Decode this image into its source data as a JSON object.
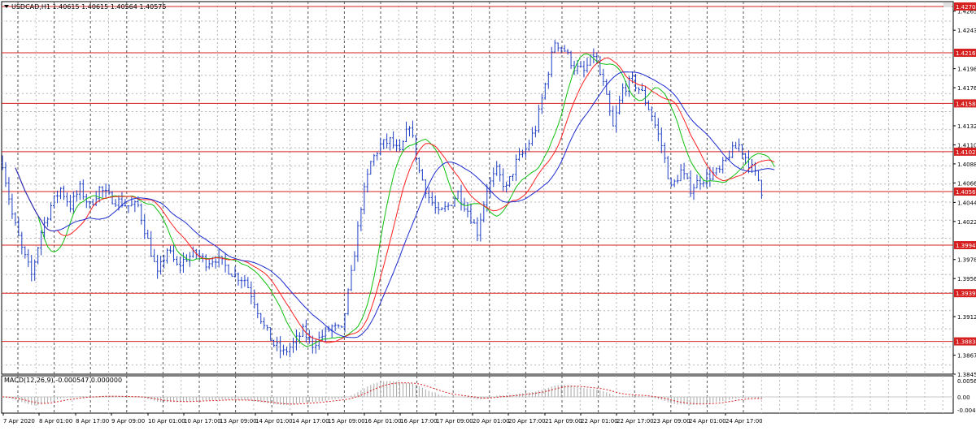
{
  "header": {
    "symbol_text": "USDCAD,H1  1.40615 1.40615 1.40564 1.40575"
  },
  "macd": {
    "label": "MACD(12,26,9) -0.000547 0.000000",
    "ticks": [
      {
        "value": 0.005615,
        "label": "0.005615"
      },
      {
        "value": 0.0,
        "label": "0.00"
      },
      {
        "value": -0.0045,
        "label": "-0.00455"
      }
    ]
  },
  "colors": {
    "background": "#ffffff",
    "grid": "#b8b8b8",
    "price_bar": "#1f3fc4",
    "level_line": "#d62020",
    "level_tag": "#d62020",
    "ma_fast": "#10c010",
    "ma_mid": "#ff2020",
    "ma_slow": "#1a2ad0",
    "macd_hist": "#a8a8a8",
    "macd_signal": "#d62020"
  },
  "chart_data": {
    "type": "candlestick",
    "symbol": "USDCAD",
    "timeframe": "H1",
    "ylim": [
      1.38455,
      1.4276
    ],
    "x_categories": [
      "7 Apr 2020",
      "8 Apr 01:00",
      "8 Apr 17:00",
      "9 Apr 09:00",
      "10 Apr 01:00",
      "10 Apr 17:00",
      "13 Apr 09:00",
      "14 Apr 01:00",
      "14 Apr 17:00",
      "15 Apr 09:00",
      "16 Apr 01:00",
      "16 Apr 17:00",
      "17 Apr 09:00",
      "20 Apr 01:00",
      "20 Apr 17:00",
      "21 Apr 09:00",
      "22 Apr 01:00",
      "22 Apr 17:00",
      "23 Apr 09:00",
      "24 Apr 01:00",
      "24 Apr 17:00"
    ],
    "y_ticks": [
      {
        "value": 1.4265,
        "label": "1.42650"
      },
      {
        "value": 1.4243,
        "label": "1.42430"
      },
      {
        "value": 1.41985,
        "label": "1.41985"
      },
      {
        "value": 1.41765,
        "label": "1.41765"
      },
      {
        "value": 1.41325,
        "label": "1.41325"
      },
      {
        "value": 1.41105,
        "label": "1.41105"
      },
      {
        "value": 1.40885,
        "label": "1.40885"
      },
      {
        "value": 1.40665,
        "label": "1.40665"
      },
      {
        "value": 1.4044,
        "label": "1.40440"
      },
      {
        "value": 1.4022,
        "label": "1.40220"
      },
      {
        "value": 1.3978,
        "label": "1.39780"
      },
      {
        "value": 1.3956,
        "label": "1.39560"
      },
      {
        "value": 1.3912,
        "label": "1.39120"
      },
      {
        "value": 1.38675,
        "label": "1.38675"
      },
      {
        "value": 1.38455,
        "label": "1.38455"
      }
    ],
    "levels": [
      {
        "value": 1.42704,
        "label": "1.42704"
      },
      {
        "value": 1.42169,
        "label": "1.42169"
      },
      {
        "value": 1.41584,
        "label": "1.41584"
      },
      {
        "value": 1.41026,
        "label": "1.41026"
      },
      {
        "value": 1.40565,
        "label": "1.40565"
      },
      {
        "value": 1.39946,
        "label": "1.39946"
      },
      {
        "value": 1.39391,
        "label": "1.39391"
      },
      {
        "value": 1.38834,
        "label": "1.38834"
      }
    ],
    "close_path": [
      [
        0,
        1.409
      ],
      [
        3,
        1.403
      ],
      [
        6,
        1.399
      ],
      [
        9,
        1.396
      ],
      [
        12,
        1.401
      ],
      [
        15,
        1.404
      ],
      [
        18,
        1.406
      ],
      [
        21,
        1.404
      ],
      [
        24,
        1.406
      ],
      [
        27,
        1.404
      ],
      [
        30,
        1.406
      ],
      [
        33,
        1.405
      ],
      [
        36,
        1.4045
      ],
      [
        39,
        1.404
      ],
      [
        42,
        1.404
      ],
      [
        45,
        1.4
      ],
      [
        48,
        1.396
      ],
      [
        51,
        1.399
      ],
      [
        54,
        1.397
      ],
      [
        57,
        1.398
      ],
      [
        60,
        1.3985
      ],
      [
        63,
        1.3975
      ],
      [
        66,
        1.398
      ],
      [
        69,
        1.397
      ],
      [
        72,
        1.396
      ],
      [
        75,
        1.3955
      ],
      [
        78,
        1.393
      ],
      [
        81,
        1.39
      ],
      [
        84,
        1.388
      ],
      [
        87,
        1.387
      ],
      [
        90,
        1.388
      ],
      [
        93,
        1.3895
      ],
      [
        96,
        1.388
      ],
      [
        99,
        1.389
      ],
      [
        102,
        1.39
      ],
      [
        105,
        1.3895
      ],
      [
        108,
        1.396
      ],
      [
        111,
        1.404
      ],
      [
        114,
        1.409
      ],
      [
        117,
        1.411
      ],
      [
        120,
        1.4115
      ],
      [
        123,
        1.41
      ],
      [
        126,
        1.4135
      ],
      [
        129,
        1.408
      ],
      [
        132,
        1.405
      ],
      [
        135,
        1.403
      ],
      [
        138,
        1.404
      ],
      [
        141,
        1.4055
      ],
      [
        144,
        1.4035
      ],
      [
        147,
        1.401
      ],
      [
        150,
        1.406
      ],
      [
        153,
        1.408
      ],
      [
        156,
        1.406
      ],
      [
        159,
        1.409
      ],
      [
        162,
        1.4105
      ],
      [
        165,
        1.413
      ],
      [
        168,
        1.418
      ],
      [
        171,
        1.423
      ],
      [
        174,
        1.422
      ],
      [
        177,
        1.42
      ],
      [
        180,
        1.4195
      ],
      [
        183,
        1.4215
      ],
      [
        186,
        1.418
      ],
      [
        189,
        1.413
      ],
      [
        192,
        1.4175
      ],
      [
        195,
        1.4185
      ],
      [
        198,
        1.417
      ],
      [
        201,
        1.4145
      ],
      [
        204,
        1.411
      ],
      [
        207,
        1.406
      ],
      [
        210,
        1.408
      ],
      [
        213,
        1.406
      ],
      [
        216,
        1.407
      ],
      [
        219,
        1.4075
      ],
      [
        222,
        1.408
      ],
      [
        225,
        1.41
      ],
      [
        228,
        1.411
      ],
      [
        231,
        1.409
      ],
      [
        234,
        1.407
      ],
      [
        235,
        1.40575
      ]
    ]
  }
}
